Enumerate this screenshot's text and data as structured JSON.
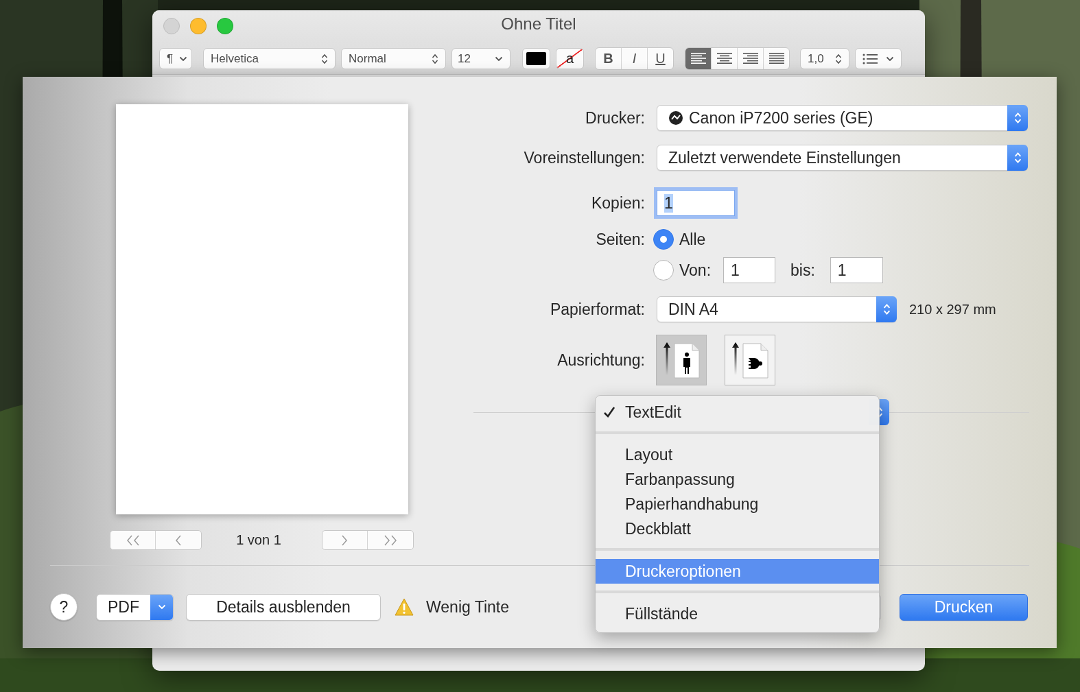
{
  "window": {
    "title": "Ohne Titel",
    "traffic_lights": [
      {
        "kind": "close",
        "disabled": true
      },
      {
        "kind": "minimize",
        "disabled": false
      },
      {
        "kind": "zoom",
        "disabled": false
      }
    ],
    "toolbar": {
      "paragraph": "¶",
      "font_family": "Helvetica",
      "font_style": "Normal",
      "font_size": "12",
      "highlight_sample": "a",
      "bold": "B",
      "italic": "I",
      "underline": "U",
      "alignments": [
        {
          "kind": "left",
          "selected": true
        },
        {
          "kind": "center",
          "selected": false
        },
        {
          "kind": "right",
          "selected": false
        },
        {
          "kind": "justify",
          "selected": false
        }
      ],
      "line_spacing": "1,0"
    }
  },
  "print_dialog": {
    "preview": {
      "page_label": "1 von 1"
    },
    "form": {
      "printer_label": "Drucker:",
      "printer": "Canon iP7200 series (GE)",
      "presets_label": "Voreinstellungen:",
      "presets": "Zuletzt verwendete Einstellungen",
      "copies_label": "Kopien:",
      "copies": "1",
      "pages_label": "Seiten:",
      "page_options": [
        {
          "label": "Alle",
          "selected": true
        },
        {
          "label": "Von:",
          "selected": false,
          "from": "1",
          "to_label": "bis:",
          "to": "1"
        }
      ],
      "paper_label": "Papierformat:",
      "paper": "DIN A4",
      "paper_size": "210 x 297 mm",
      "orientation_label": "Ausrichtung:",
      "orientations": [
        {
          "kind": "portrait",
          "selected": true
        },
        {
          "kind": "landscape",
          "selected": false
        }
      ]
    },
    "menu": {
      "sections": [
        [
          {
            "label": "TextEdit",
            "checked": true,
            "selected": false
          }
        ],
        [
          {
            "label": "Layout",
            "checked": false,
            "selected": false
          },
          {
            "label": "Farbanpassung",
            "checked": false,
            "selected": false
          },
          {
            "label": "Papierhandhabung",
            "checked": false,
            "selected": false
          },
          {
            "label": "Deckblatt",
            "checked": false,
            "selected": false
          }
        ],
        [
          {
            "label": "Druckeroptionen",
            "checked": false,
            "selected": true
          }
        ],
        [
          {
            "label": "Füllstände",
            "checked": false,
            "selected": false
          }
        ]
      ]
    },
    "bottom": {
      "help": "?",
      "pdf": "PDF",
      "details": "Details ausblenden",
      "warning": "Wenig Tinte",
      "print": "Drucken"
    }
  }
}
